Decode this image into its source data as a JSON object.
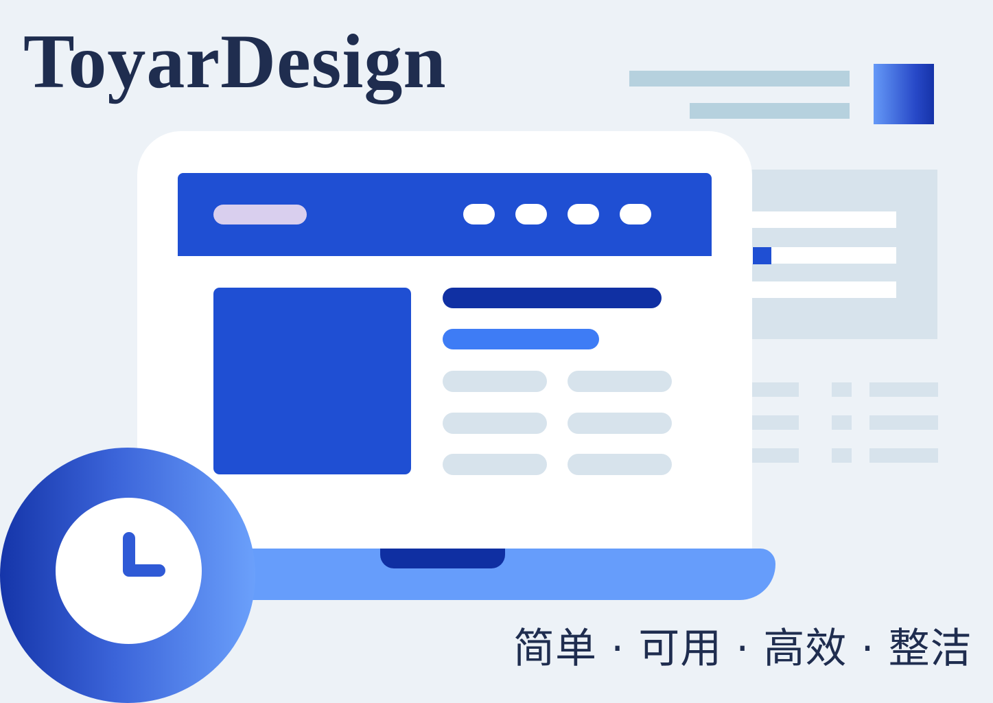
{
  "brand": {
    "title": "ToyarDesign"
  },
  "slogan": "简单 · 可用 · 高效 · 整洁",
  "colors": {
    "background": "#edf2f7",
    "primary": "#1f4fd3",
    "primary_dark": "#1030a3",
    "primary_light": "#669dfb",
    "accent_blue": "#3e7cf5",
    "logo_pill": "#d9cfee",
    "muted": "#d7e3ec",
    "text_dark": "#1f2d4f"
  },
  "icons": {
    "badge": "clock-icon"
  }
}
